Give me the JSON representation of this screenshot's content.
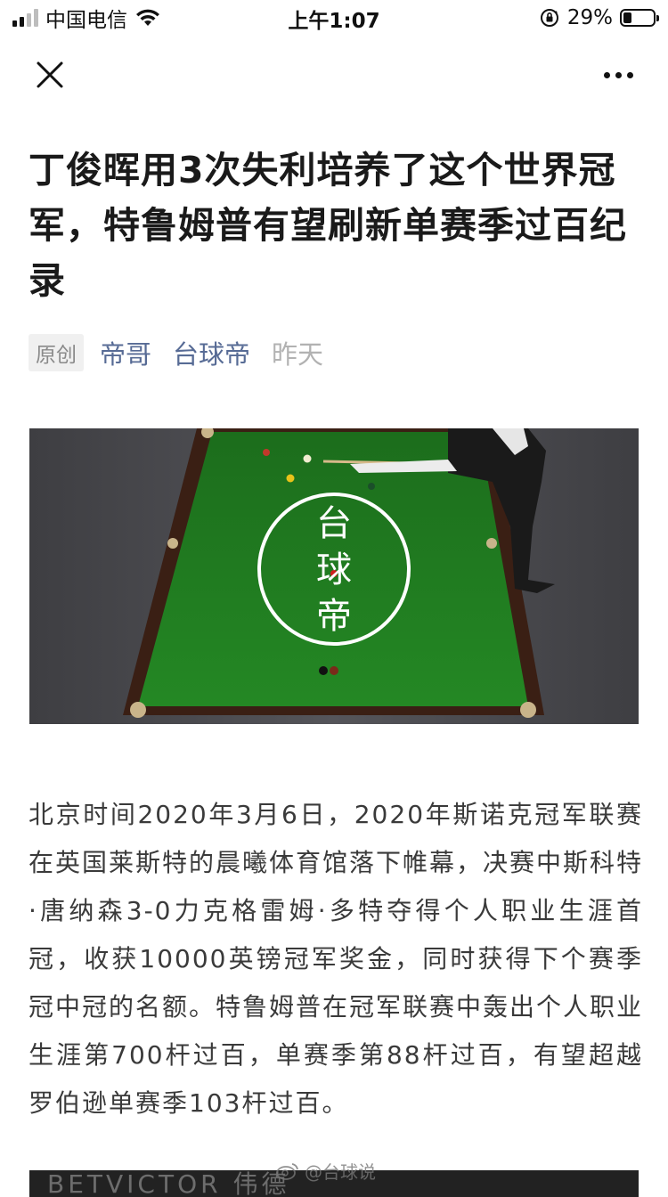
{
  "status_bar": {
    "carrier": "中国电信",
    "time": "上午1:07",
    "battery_percent": "29%",
    "battery_level": 0.29,
    "signal_bars_total": 4,
    "signal_bars_active": 2
  },
  "nav": {
    "close_icon": "close-icon",
    "more_icon": "more-icon"
  },
  "article": {
    "title": "丁俊晖用3次失利培养了这个世界冠军，特鲁姆普有望刷新单赛季过百纪录",
    "tag": "原创",
    "author": "帝哥",
    "account": "台球帝",
    "date": "昨天",
    "hero_logo_text": [
      "台",
      "球",
      "帝"
    ],
    "paragraph": "北京时间2020年3月6日，2020年斯诺克冠军联赛在英国莱斯特的晨曦体育馆落下帷幕，决赛中斯科特·唐纳森3-0力克格雷姆·多特夺得个人职业生涯首冠，收获10000英镑冠军奖金，同时获得下个赛季冠中冠的名额。特鲁姆普在冠军联赛中轰出个人职业生涯第700杆过百，单赛季第88杆过百，有望超越罗伯逊单赛季103杆过百。",
    "bottom_image_text": "BETVICTOR 伟德",
    "watermark": "@台球说"
  },
  "colors": {
    "link": "#576b95",
    "date": "#b2b2b2",
    "felt": "#1f7a1f",
    "body_text": "#3a3a3a"
  }
}
